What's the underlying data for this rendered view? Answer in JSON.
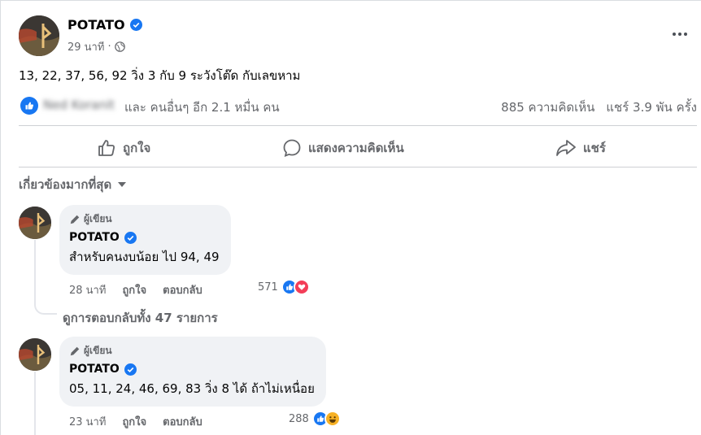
{
  "post": {
    "author": "POTATO",
    "time": "29 นาที",
    "separator": "·",
    "text": "13, 22, 37, 56, 92 วิ่ง 3 กับ 9 ระวังโต๊ด กับเลขหาม",
    "reactor_blurred": "Ned Koranit",
    "reactions_text": "และ คนอื่นๆ อีก 2.1 หมื่น คน",
    "comments_count": "885 ความคิดเห็น",
    "shares_count": "แชร์ 3.9 พัน ครั้ง"
  },
  "actions": {
    "like": "ถูกใจ",
    "comment": "แสดงความคิดเห็น",
    "share": "แชร์"
  },
  "sort": {
    "label": "เกี่ยวข้องมากที่สุด"
  },
  "comments": [
    {
      "badge": "ผู้เขียน",
      "author": "POTATO",
      "text": "สำหรับคนงบน้อย ไป 94, 49",
      "time": "28 นาที",
      "like": "ถูกใจ",
      "reply": "ตอบกลับ",
      "reaction_count": "571",
      "view_replies": "ดูการตอบกลับทั้ง 47 รายการ"
    },
    {
      "badge": "ผู้เขียน",
      "author": "POTATO",
      "text": "05, 11, 24, 46, 69, 83 วิ่ง 8 ได้ ถ้าไม่เหนื่อย",
      "time": "23 นาที",
      "like": "ถูกใจ",
      "reply": "ตอบกลับ",
      "reaction_count": "288"
    }
  ],
  "colors": {
    "brand_blue": "#1877f2",
    "secondary_text": "#65676b",
    "bubble_bg": "#f0f2f5",
    "love_red": "#f33e58",
    "haha_yellow": "#f7b125"
  },
  "icons": {
    "verified": "verified-badge-icon",
    "privacy": "globe-icon",
    "more": "more-options-icon",
    "like": "thumbs-up-icon",
    "comment": "speech-bubble-icon",
    "share": "share-arrow-icon",
    "author_badge": "pencil-icon"
  }
}
